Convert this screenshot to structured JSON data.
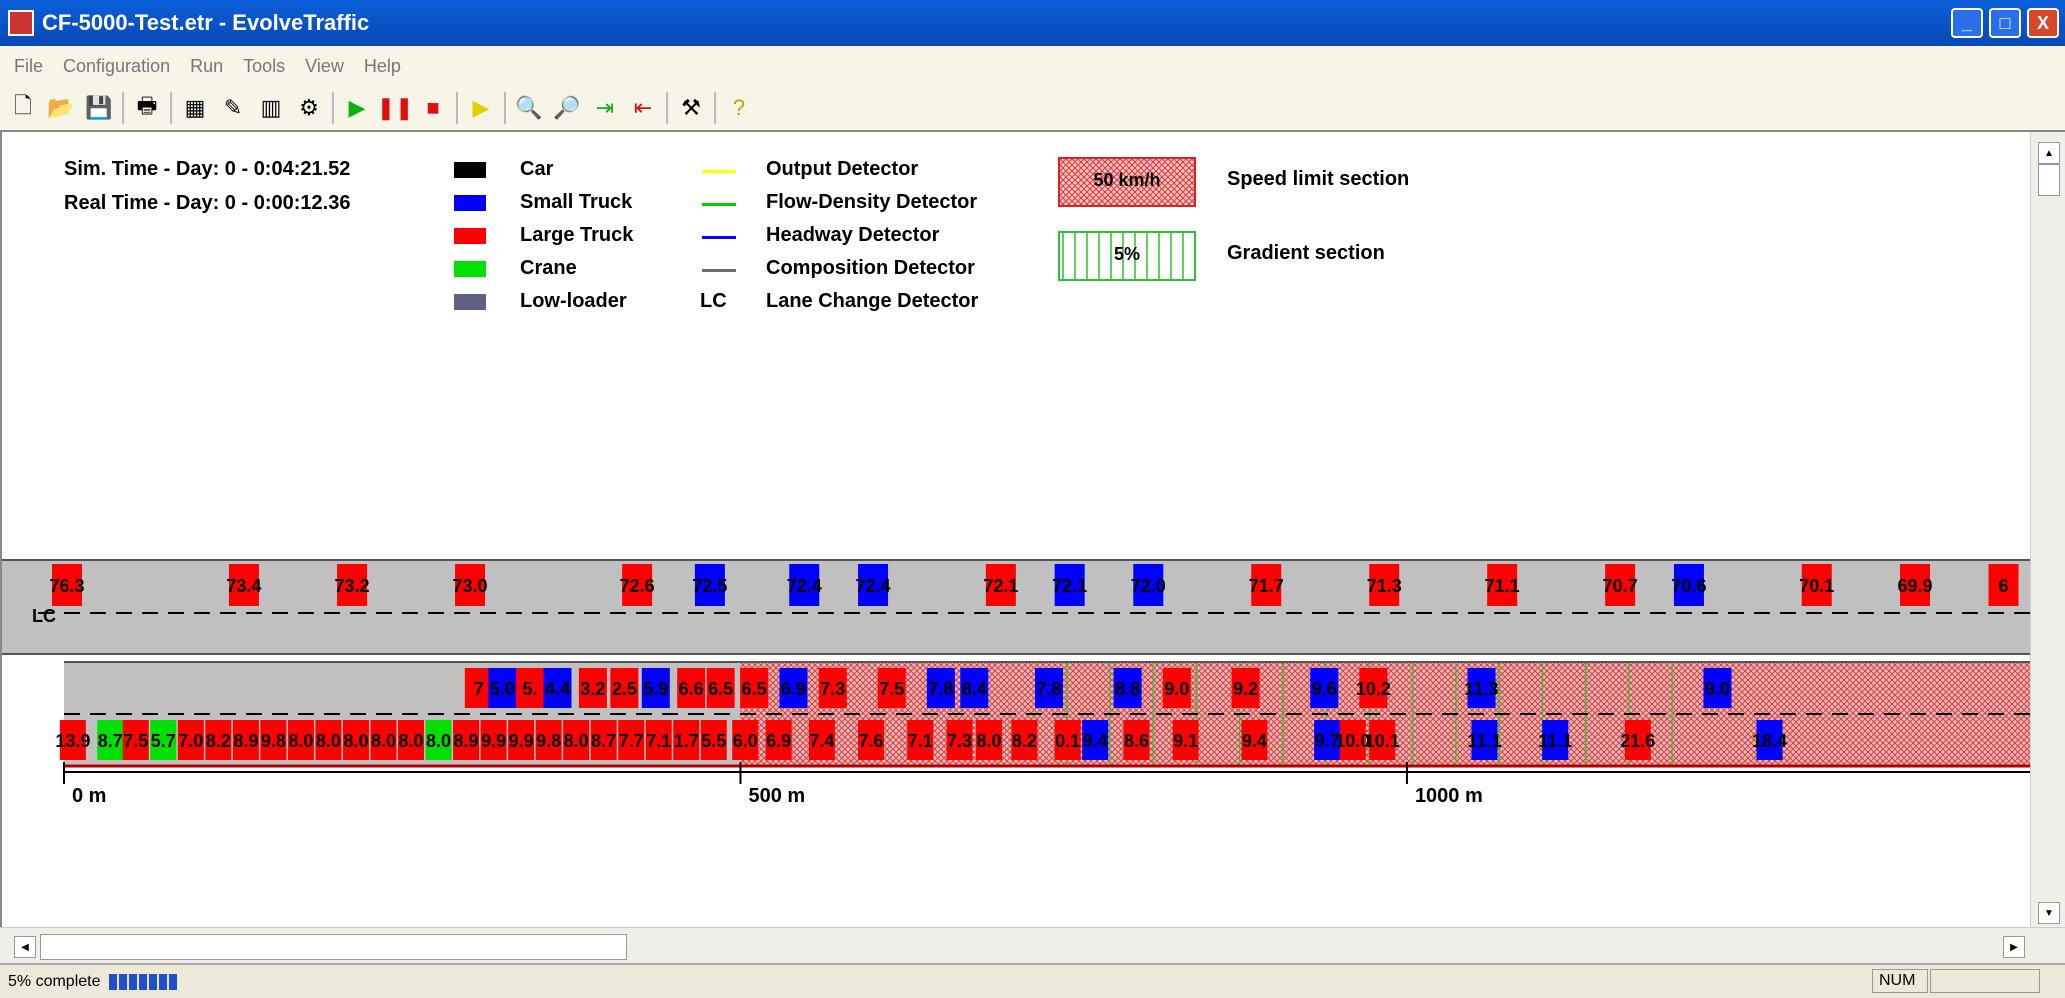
{
  "window": {
    "title": "CF-5000-Test.etr - EvolveTraffic",
    "controls": {
      "minimize": "_",
      "maximize": "□",
      "close": "X"
    }
  },
  "menu": [
    "File",
    "Configuration",
    "Run",
    "Tools",
    "View",
    "Help"
  ],
  "toolbar": [
    "new-file-icon",
    "open-folder-icon",
    "save-icon",
    "print-icon",
    "config-icon",
    "edit-icon",
    "chart-icon",
    "tools-icon",
    "play-icon",
    "pause-icon",
    "stop-icon",
    "step-icon",
    "zoom-in-icon",
    "zoom-out-icon",
    "pan-right-icon",
    "pan-left-icon",
    "hammer-icon",
    "help-icon"
  ],
  "info": {
    "sim_time": "Sim. Time - Day: 0 - 0:04:21.52",
    "real_time": "Real Time - Day: 0 - 0:00:12.36"
  },
  "legend": {
    "vehicles": [
      {
        "label": "Car",
        "color": "#000000"
      },
      {
        "label": "Small Truck",
        "color": "#0000ff"
      },
      {
        "label": "Large Truck",
        "color": "#ff0000"
      },
      {
        "label": "Crane",
        "color": "#00e000"
      },
      {
        "label": "Low-loader",
        "color": "#606080"
      }
    ],
    "detectors": [
      {
        "label": "Output Detector",
        "color": "#ffff00",
        "symbol": ""
      },
      {
        "label": "Flow-Density Detector",
        "color": "#00d000",
        "symbol": ""
      },
      {
        "label": "Headway Detector",
        "color": "#0000ff",
        "symbol": ""
      },
      {
        "label": "Composition Detector",
        "color": "#707070",
        "symbol": ""
      },
      {
        "label": "Lane Change Detector",
        "color": "",
        "symbol": "LC"
      }
    ],
    "sections": [
      {
        "swatch_text": "50 km/h",
        "label": "Speed limit section"
      },
      {
        "swatch_text": "5%",
        "label": "Gradient section"
      }
    ]
  },
  "road": {
    "lc_label": "LC",
    "scale_labels": [
      "0 m",
      "500 m",
      "1000 m"
    ],
    "top_lane_vehicles": [
      {
        "pos": 0.0,
        "type": "red",
        "speed": "76.3"
      },
      {
        "pos": 0.09,
        "type": "red",
        "speed": "73.4"
      },
      {
        "pos": 0.145,
        "type": "red",
        "speed": "73.2"
      },
      {
        "pos": 0.205,
        "type": "red",
        "speed": "73.0"
      },
      {
        "pos": 0.29,
        "type": "red",
        "speed": "72.6"
      },
      {
        "pos": 0.327,
        "type": "blue",
        "speed": "72.5"
      },
      {
        "pos": 0.375,
        "type": "blue",
        "speed": "72.4"
      },
      {
        "pos": 0.41,
        "type": "blue",
        "speed": "72.4"
      },
      {
        "pos": 0.475,
        "type": "red",
        "speed": "72.1"
      },
      {
        "pos": 0.51,
        "type": "blue",
        "speed": "72.1"
      },
      {
        "pos": 0.55,
        "type": "blue",
        "speed": "72.0"
      },
      {
        "pos": 0.61,
        "type": "red",
        "speed": "71.7"
      },
      {
        "pos": 0.67,
        "type": "red",
        "speed": "71.3"
      },
      {
        "pos": 0.73,
        "type": "red",
        "speed": "71.1"
      },
      {
        "pos": 0.79,
        "type": "red",
        "speed": "70.7"
      },
      {
        "pos": 0.825,
        "type": "blue",
        "speed": "70.6"
      },
      {
        "pos": 0.89,
        "type": "red",
        "speed": "70.1"
      },
      {
        "pos": 0.94,
        "type": "red",
        "speed": "69.9"
      },
      {
        "pos": 0.985,
        "type": "red",
        "speed": "6"
      }
    ],
    "middle_lane_vehicles": [
      {
        "pos": 0.21,
        "type": "red",
        "speed": "7"
      },
      {
        "pos": 0.222,
        "type": "blue",
        "speed": "5.0"
      },
      {
        "pos": 0.236,
        "type": "red",
        "speed": "5."
      },
      {
        "pos": 0.25,
        "type": "blue",
        "speed": "4.4"
      },
      {
        "pos": 0.268,
        "type": "red",
        "speed": "3.2"
      },
      {
        "pos": 0.284,
        "type": "red",
        "speed": "2.5"
      },
      {
        "pos": 0.3,
        "type": "blue",
        "speed": "5.9"
      },
      {
        "pos": 0.318,
        "type": "red",
        "speed": "6.6"
      },
      {
        "pos": 0.333,
        "type": "red",
        "speed": "6.5"
      },
      {
        "pos": 0.35,
        "type": "red",
        "speed": "6.5"
      },
      {
        "pos": 0.37,
        "type": "blue",
        "speed": "6.9"
      },
      {
        "pos": 0.39,
        "type": "red",
        "speed": "7.3"
      },
      {
        "pos": 0.42,
        "type": "red",
        "speed": "7.5"
      },
      {
        "pos": 0.445,
        "type": "blue",
        "speed": "7.8"
      },
      {
        "pos": 0.462,
        "type": "blue",
        "speed": "8.4"
      },
      {
        "pos": 0.5,
        "type": "blue",
        "speed": "7.8"
      },
      {
        "pos": 0.54,
        "type": "blue",
        "speed": "8.8"
      },
      {
        "pos": 0.565,
        "type": "red",
        "speed": "9.0"
      },
      {
        "pos": 0.6,
        "type": "red",
        "speed": "9.2"
      },
      {
        "pos": 0.64,
        "type": "blue",
        "speed": "9.6"
      },
      {
        "pos": 0.665,
        "type": "red",
        "speed": "10.2"
      },
      {
        "pos": 0.72,
        "type": "blue",
        "speed": "11.3"
      },
      {
        "pos": 0.84,
        "type": "blue",
        "speed": "9.0"
      }
    ],
    "bottom_lane_vehicles": [
      {
        "pos": 0.004,
        "type": "red",
        "speed": "13.9"
      },
      {
        "pos": 0.023,
        "type": "green",
        "speed": "8.7"
      },
      {
        "pos": 0.036,
        "type": "red",
        "speed": "7.5"
      },
      {
        "pos": 0.05,
        "type": "green",
        "speed": "5.7"
      },
      {
        "pos": 0.064,
        "type": "red",
        "speed": "7.0"
      },
      {
        "pos": 0.078,
        "type": "red",
        "speed": "8.2"
      },
      {
        "pos": 0.092,
        "type": "red",
        "speed": "8.9"
      },
      {
        "pos": 0.106,
        "type": "red",
        "speed": "9.8"
      },
      {
        "pos": 0.12,
        "type": "red",
        "speed": "8.0"
      },
      {
        "pos": 0.134,
        "type": "red",
        "speed": "8.0"
      },
      {
        "pos": 0.148,
        "type": "red",
        "speed": "8.0"
      },
      {
        "pos": 0.162,
        "type": "red",
        "speed": "8.0"
      },
      {
        "pos": 0.176,
        "type": "red",
        "speed": "8.0"
      },
      {
        "pos": 0.19,
        "type": "green",
        "speed": "8.0"
      },
      {
        "pos": 0.204,
        "type": "red",
        "speed": "8.9"
      },
      {
        "pos": 0.218,
        "type": "red",
        "speed": "9.9"
      },
      {
        "pos": 0.232,
        "type": "red",
        "speed": "9.9"
      },
      {
        "pos": 0.246,
        "type": "red",
        "speed": "9.8"
      },
      {
        "pos": 0.26,
        "type": "red",
        "speed": "8.0"
      },
      {
        "pos": 0.274,
        "type": "red",
        "speed": "8.7"
      },
      {
        "pos": 0.288,
        "type": "red",
        "speed": "7.7"
      },
      {
        "pos": 0.302,
        "type": "red",
        "speed": "7.1"
      },
      {
        "pos": 0.316,
        "type": "red",
        "speed": "1.7"
      },
      {
        "pos": 0.33,
        "type": "red",
        "speed": "5.5"
      },
      {
        "pos": 0.346,
        "type": "red",
        "speed": "6.0"
      },
      {
        "pos": 0.363,
        "type": "red",
        "speed": "6.9"
      },
      {
        "pos": 0.385,
        "type": "red",
        "speed": "7.4"
      },
      {
        "pos": 0.41,
        "type": "red",
        "speed": "7.6"
      },
      {
        "pos": 0.435,
        "type": "red",
        "speed": "7.1"
      },
      {
        "pos": 0.455,
        "type": "red",
        "speed": "7.3"
      },
      {
        "pos": 0.47,
        "type": "red",
        "speed": "8.0"
      },
      {
        "pos": 0.488,
        "type": "red",
        "speed": "8.2"
      },
      {
        "pos": 0.51,
        "type": "red",
        "speed": "0.1"
      },
      {
        "pos": 0.524,
        "type": "blue",
        "speed": "9.4"
      },
      {
        "pos": 0.545,
        "type": "red",
        "speed": "8.6"
      },
      {
        "pos": 0.57,
        "type": "red",
        "speed": "9.1"
      },
      {
        "pos": 0.605,
        "type": "red",
        "speed": "9.4"
      },
      {
        "pos": 0.642,
        "type": "blue",
        "speed": "9.7"
      },
      {
        "pos": 0.655,
        "type": "red",
        "speed": "10.0"
      },
      {
        "pos": 0.67,
        "type": "red",
        "speed": "10.1"
      },
      {
        "pos": 0.722,
        "type": "blue",
        "speed": "11.1"
      },
      {
        "pos": 0.758,
        "type": "blue",
        "speed": "11.1"
      },
      {
        "pos": 0.8,
        "type": "red",
        "speed": "21.6"
      },
      {
        "pos": 0.867,
        "type": "blue",
        "speed": "18.4"
      }
    ]
  },
  "status": {
    "progress_text": "5% complete",
    "progress_blocks": 7,
    "num_indicator": "NUM"
  }
}
